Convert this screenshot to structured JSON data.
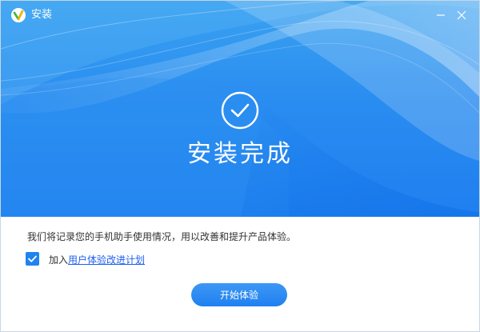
{
  "window": {
    "title": "安装"
  },
  "titlebar_buttons": {
    "minimize": "minimize-icon",
    "close": "close-icon"
  },
  "banner": {
    "status_icon": "check-circle-icon",
    "title": "安装完成"
  },
  "content": {
    "notice": "我们将记录您的手机助手使用情况，用以改善和提升产品体验。",
    "join_checkbox": {
      "checked": true,
      "prefix": "加入",
      "link_text": "用户体验改进计划"
    },
    "start_button_label": "开始体验"
  },
  "colors": {
    "primary_blue": "#1f80ef",
    "link_blue": "#1f5ff0"
  }
}
